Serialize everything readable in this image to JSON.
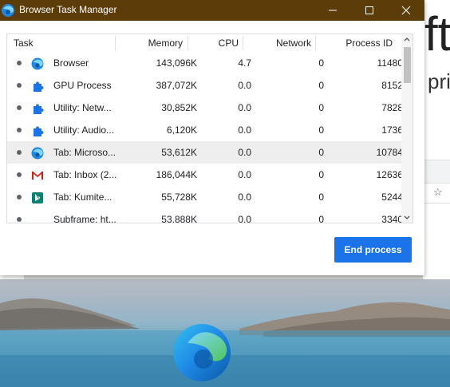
{
  "window": {
    "title": "Browser Task Manager"
  },
  "columns": {
    "task": "Task",
    "memory": "Memory",
    "cpu": "CPU",
    "network": "Network",
    "pid": "Process ID"
  },
  "rows": [
    {
      "task": "Browser",
      "memory": "143,096K",
      "cpu": "4.7",
      "network": "0",
      "pid": "11480",
      "icon": "edge-icon"
    },
    {
      "task": "GPU Process",
      "memory": "387,072K",
      "cpu": "0.0",
      "network": "0",
      "pid": "8152",
      "icon": "puzzle-icon"
    },
    {
      "task": "Utility: Netw...",
      "memory": "30,852K",
      "cpu": "0.0",
      "network": "0",
      "pid": "7828",
      "icon": "puzzle-icon"
    },
    {
      "task": "Utility: Audio...",
      "memory": "6,120K",
      "cpu": "0.0",
      "network": "0",
      "pid": "1736",
      "icon": "puzzle-icon"
    },
    {
      "task": "Tab: Microso...",
      "memory": "53,612K",
      "cpu": "0.0",
      "network": "0",
      "pid": "10784",
      "icon": "edge-icon",
      "selected": true
    },
    {
      "task": "Tab: Inbox (2...",
      "memory": "186,044K",
      "cpu": "0.0",
      "network": "0",
      "pid": "12636",
      "icon": "gmail-icon"
    },
    {
      "task": "Tab: Kumite...",
      "memory": "55,728K",
      "cpu": "0.0",
      "network": "0",
      "pid": "5244",
      "icon": "bing-icon"
    },
    {
      "task": "Subframe: ht...",
      "memory": "53,888K",
      "cpu": "0.0",
      "network": "0",
      "pid": "3340",
      "icon": "none"
    }
  ],
  "actions": {
    "end_process": "End process"
  },
  "background": {
    "big_text": "ft",
    "small_text": "pri",
    "star": "☆"
  },
  "colors": {
    "titlebar": "#5c3c08",
    "accent": "#1a73e8",
    "selected_row": "#eeeeee"
  }
}
